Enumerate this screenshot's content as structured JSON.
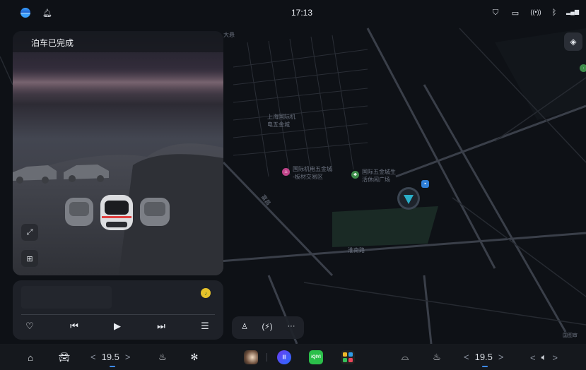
{
  "status_bar": {
    "time": "17:13",
    "left_icons": [
      "app-logo-icon",
      "bell-icon"
    ],
    "right_icons": [
      "shield-icon",
      "dashcam-icon",
      "radio-signal-icon",
      "bluetooth-icon",
      "cellular-5g-icon"
    ]
  },
  "map": {
    "labels": {
      "area_main": "上海国际机\n电五金城",
      "poi_a": "国际机电五金城\n-板材交易区",
      "poi_b": "国际五金城生\n活休闲广场",
      "road_a": "大悬",
      "road_b": "泡咪",
      "road_c": "富昌",
      "road_d": "淮南路",
      "watermark": "国图审"
    },
    "colors": {
      "background": "#0e1116",
      "road": "#353a44",
      "grid": "#2b2f37",
      "park": "#1c2b26",
      "nav_arrow": "#2aaec8"
    }
  },
  "parking_panel": {
    "title": "泊车已完成",
    "icons": [
      "exit-fullscreen-icon",
      "parking-add-icon"
    ]
  },
  "media": {
    "controls": [
      "heart-icon",
      "previous-track-icon",
      "play-icon",
      "next-track-icon",
      "playlist-icon"
    ]
  },
  "quick_menu": {
    "icons": [
      "person-stand-icon",
      "signal-wave-icon",
      "more-icon"
    ],
    "more_label": "···"
  },
  "dock": {
    "left_temp": "19.5",
    "right_temp": "19.5",
    "prev_label": "<",
    "next_label": ">",
    "icons": [
      "home-icon",
      "car-icon",
      "seat-heat-icon",
      "fan-icon",
      "windshield-defrost-icon",
      "seat-heat-right-icon",
      "volume-icon"
    ],
    "apps": [
      "assistant-app",
      "voice-app",
      "iqiyi-app",
      "app-grid-app"
    ],
    "iqiyi_label": "iQIYI"
  }
}
